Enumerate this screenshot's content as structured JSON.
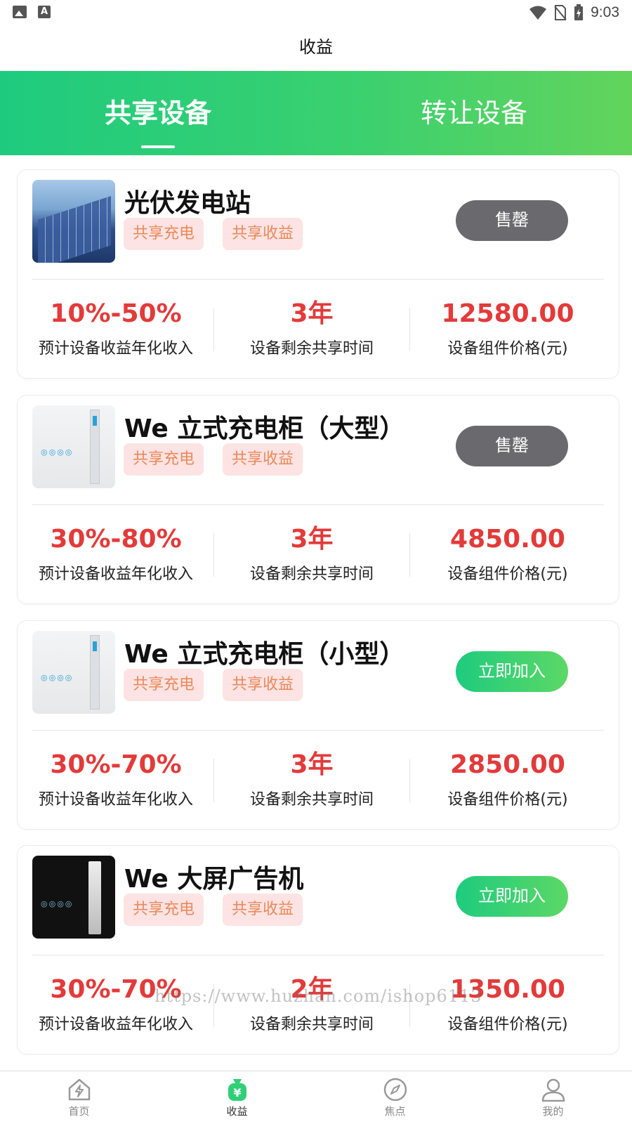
{
  "status_bar": {
    "time": "9:03"
  },
  "header": {
    "title": "收益"
  },
  "tabs": [
    {
      "label": "共享设备",
      "active": true
    },
    {
      "label": "转让设备",
      "active": false
    }
  ],
  "colors": {
    "accent_green": "#1ecb7e",
    "price_red": "#e33a3a",
    "tag_bg": "#fde3e3",
    "tag_text": "#e98a5a",
    "sold_gray": "#6a6a6e"
  },
  "devices": [
    {
      "title": "光伏发电站",
      "image": "solar-panel-image",
      "tags": [
        "共享充电",
        "共享收益"
      ],
      "button": "售罄",
      "button_state": "sold_out",
      "stats": [
        {
          "value": "10%-50%",
          "label": "预计设备收益年化收入"
        },
        {
          "value": "3年",
          "label": "设备剩余共享时间"
        },
        {
          "value": "12580.00",
          "label": "设备组件价格(元)"
        }
      ]
    },
    {
      "title": "We 立式充电柜（大型）",
      "image": "charging-cabinet-image",
      "tags": [
        "共享充电",
        "共享收益"
      ],
      "button": "售罄",
      "button_state": "sold_out",
      "stats": [
        {
          "value": "30%-80%",
          "label": "预计设备收益年化收入"
        },
        {
          "value": "3年",
          "label": "设备剩余共享时间"
        },
        {
          "value": "4850.00",
          "label": "设备组件价格(元)"
        }
      ]
    },
    {
      "title": "We 立式充电柜（小型）",
      "image": "charging-cabinet-image",
      "tags": [
        "共享充电",
        "共享收益"
      ],
      "button": "立即加入",
      "button_state": "available",
      "stats": [
        {
          "value": "30%-70%",
          "label": "预计设备收益年化收入"
        },
        {
          "value": "3年",
          "label": "设备剩余共享时间"
        },
        {
          "value": "2850.00",
          "label": "设备组件价格(元)"
        }
      ]
    },
    {
      "title": "We 大屏广告机",
      "image": "ad-screen-image",
      "tags": [
        "共享充电",
        "共享收益"
      ],
      "button": "立即加入",
      "button_state": "available",
      "stats": [
        {
          "value": "30%-70%",
          "label": "预计设备收益年化收入"
        },
        {
          "value": "2年",
          "label": "设备剩余共享时间"
        },
        {
          "value": "1350.00",
          "label": "设备组件价格(元)"
        }
      ]
    }
  ],
  "watermark": "https://www.huzhan.com/ishop6113",
  "bottom_nav": [
    {
      "label": "首页",
      "icon": "home-bolt-icon",
      "active": false
    },
    {
      "label": "收益",
      "icon": "money-bag-icon",
      "active": true
    },
    {
      "label": "焦点",
      "icon": "compass-icon",
      "active": false
    },
    {
      "label": "我的",
      "icon": "user-icon",
      "active": false
    }
  ]
}
